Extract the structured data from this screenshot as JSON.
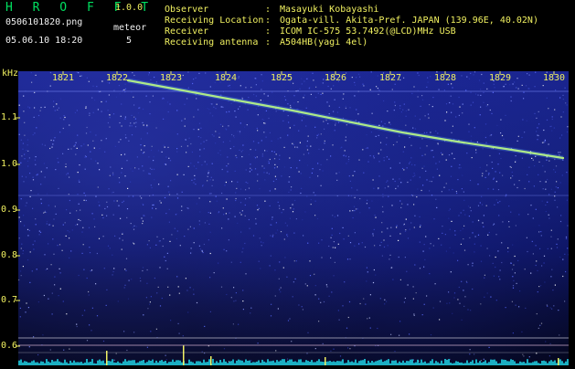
{
  "app": {
    "brand": "H R O F F T",
    "version": "1.0.0"
  },
  "capture": {
    "filename": "0506101820.png",
    "datetime": "05.06.10 18:20"
  },
  "meteor": {
    "label": "meteor",
    "count": "5"
  },
  "station": [
    {
      "key": "Observer",
      "value": "Masayuki Kobayashi"
    },
    {
      "key": "Receiving Location",
      "value": "Ogata-vill. Akita-Pref. JAPAN (139.96E, 40.02N)"
    },
    {
      "key": "Receiver",
      "value": "ICOM IC-575 53.7492(@LCD)MHz USB"
    },
    {
      "key": "Receiving antenna",
      "value": "A504HB(yagi 4el)"
    }
  ],
  "separator": ":",
  "axis": {
    "y_unit": "kHz",
    "y_ticks": [
      "1.1",
      "1.0",
      "0.9",
      "0.8",
      "0.7",
      "0.6"
    ],
    "x_ticks": [
      "1821",
      "1822",
      "1823",
      "1824",
      "1825",
      "1826",
      "1827",
      "1828",
      "1829",
      "1830"
    ]
  },
  "colors": {
    "background": "#000000",
    "label_yellow": "#f0f060",
    "brand_green": "#00e060",
    "echo_trace": "#c8ff60",
    "noise_blue": "#1a2590"
  }
}
